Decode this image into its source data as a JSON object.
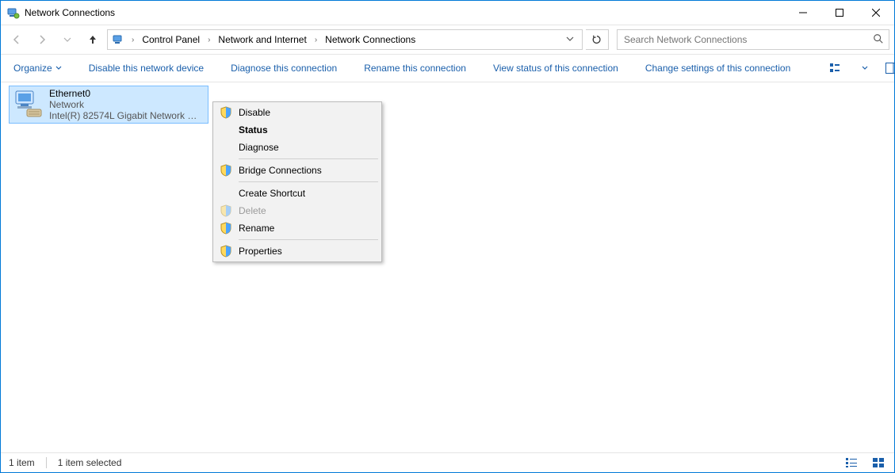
{
  "window": {
    "title": "Network Connections"
  },
  "breadcrumb": {
    "items": [
      "Control Panel",
      "Network and Internet",
      "Network Connections"
    ]
  },
  "search": {
    "placeholder": "Search Network Connections"
  },
  "commands": {
    "organize": "Organize",
    "disable_device": "Disable this network device",
    "diagnose": "Diagnose this connection",
    "rename": "Rename this connection",
    "view_status": "View status of this connection",
    "change_settings": "Change settings of this connection"
  },
  "adapter": {
    "name": "Ethernet0",
    "network": "Network",
    "device": "Intel(R) 82574L Gigabit Network C..."
  },
  "context_menu": {
    "disable": "Disable",
    "status": "Status",
    "diagnose": "Diagnose",
    "bridge": "Bridge Connections",
    "create_shortcut": "Create Shortcut",
    "delete": "Delete",
    "rename": "Rename",
    "properties": "Properties"
  },
  "statusbar": {
    "count": "1 item",
    "selected": "1 item selected"
  }
}
